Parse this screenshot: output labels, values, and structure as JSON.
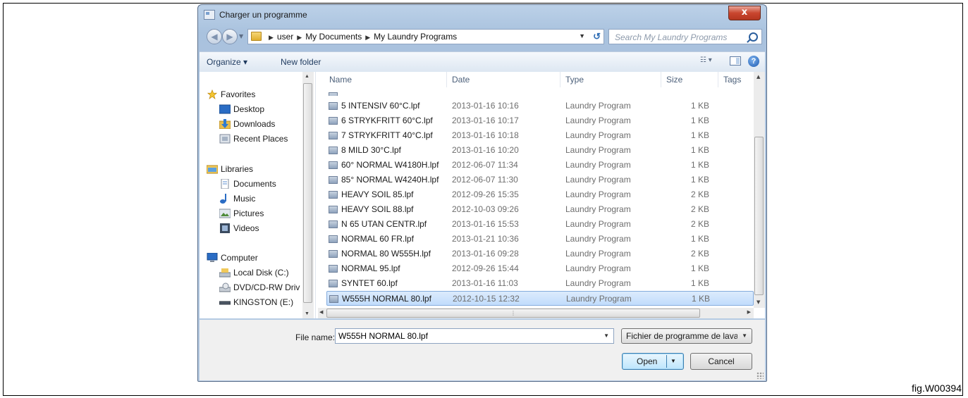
{
  "window": {
    "title": "Charger un programme",
    "close_label": "x"
  },
  "address": {
    "crumbs": [
      "user",
      "My Documents",
      "My Laundry Programs"
    ]
  },
  "search": {
    "placeholder": "Search My Laundry Programs"
  },
  "toolbar": {
    "organize": "Organize ▾",
    "new_folder": "New folder"
  },
  "sidebar": {
    "favorites": {
      "label": "Favorites",
      "items": [
        "Desktop",
        "Downloads",
        "Recent Places"
      ]
    },
    "libraries": {
      "label": "Libraries",
      "items": [
        "Documents",
        "Music",
        "Pictures",
        "Videos"
      ]
    },
    "computer": {
      "label": "Computer",
      "items": [
        "Local Disk (C:)",
        "DVD/CD-RW Driv",
        "KINGSTON (E:)"
      ]
    }
  },
  "columns": {
    "name": "Name",
    "date": "Date",
    "type": "Type",
    "size": "Size",
    "tags": "Tags"
  },
  "files": [
    {
      "name": "5 INTENSIV 60°C.lpf",
      "date": "2013-01-16 10:16",
      "type": "Laundry Program",
      "size": "1 KB"
    },
    {
      "name": "6 STRYKFRITT 60°C.lpf",
      "date": "2013-01-16 10:17",
      "type": "Laundry Program",
      "size": "1 KB"
    },
    {
      "name": "7 STRYKFRITT 40°C.lpf",
      "date": "2013-01-16 10:18",
      "type": "Laundry Program",
      "size": "1 KB"
    },
    {
      "name": "8 MILD 30°C.lpf",
      "date": "2013-01-16 10:20",
      "type": "Laundry Program",
      "size": "1 KB"
    },
    {
      "name": "60° NORMAL W4180H.lpf",
      "date": "2012-06-07 11:34",
      "type": "Laundry Program",
      "size": "1 KB"
    },
    {
      "name": "85° NORMAL W4240H.lpf",
      "date": "2012-06-07 11:30",
      "type": "Laundry Program",
      "size": "1 KB"
    },
    {
      "name": "HEAVY SOIL 85.lpf",
      "date": "2012-09-26 15:35",
      "type": "Laundry Program",
      "size": "2 KB"
    },
    {
      "name": "HEAVY SOIL 88.lpf",
      "date": "2012-10-03 09:26",
      "type": "Laundry Program",
      "size": "2 KB"
    },
    {
      "name": "N 65 UTAN CENTR.lpf",
      "date": "2013-01-16 15:53",
      "type": "Laundry Program",
      "size": "2 KB"
    },
    {
      "name": "NORMAL 60 FR.lpf",
      "date": "2013-01-21 10:36",
      "type": "Laundry Program",
      "size": "1 KB"
    },
    {
      "name": "NORMAL 80 W555H.lpf",
      "date": "2013-01-16 09:28",
      "type": "Laundry Program",
      "size": "2 KB"
    },
    {
      "name": "NORMAL 95.lpf",
      "date": "2012-09-26 15:44",
      "type": "Laundry Program",
      "size": "1 KB"
    },
    {
      "name": "SYNTET 60.lpf",
      "date": "2013-01-16 11:03",
      "type": "Laundry Program",
      "size": "1 KB"
    },
    {
      "name": "W555H NORMAL 80.lpf",
      "date": "2012-10-15 12:32",
      "type": "Laundry Program",
      "size": "1 KB"
    }
  ],
  "selected_file": "W555H NORMAL 80.lpf",
  "filename": {
    "label": "File name:",
    "value": "W555H NORMAL 80.lpf"
  },
  "filetype": {
    "value": "Fichier de programme de lavag"
  },
  "buttons": {
    "open": "Open",
    "cancel": "Cancel"
  },
  "figure_label": "fig.W00394",
  "colors": {
    "selection": "#c1dcfc",
    "close_button": "#c9462f",
    "window_frame": "#a9c2de"
  }
}
